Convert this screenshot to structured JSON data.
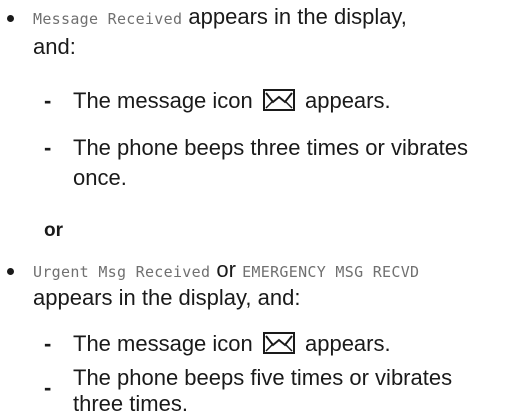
{
  "item1": {
    "lcd_text": "Message Received",
    "text_after": " appears in the display,",
    "line2": "and:",
    "sub1": {
      "text_before": "The message icon ",
      "icon": "message-envelope-icon",
      "text_after": " appears."
    },
    "sub2": {
      "line1": "The phone beeps three times or vibrates",
      "line2": "once."
    }
  },
  "or_label": "or",
  "item2": {
    "lcd_text1": "Urgent Msg Received",
    "mid_text": " or ",
    "lcd_text2": "EMERGENCY MSG RECVD",
    "line2": "appears in the display, and:",
    "sub1": {
      "text_before": "The message icon ",
      "icon": "message-envelope-icon",
      "text_after": " appears."
    },
    "sub2": {
      "line1": "The phone beeps five times or vibrates",
      "line2": "three times."
    }
  },
  "dash_char": "-"
}
